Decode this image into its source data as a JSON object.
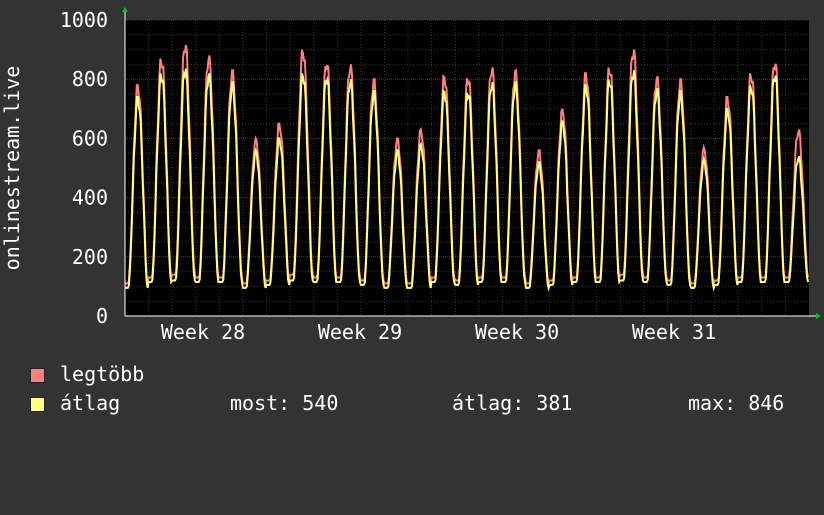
{
  "chart_data": {
    "type": "line",
    "ylabel": "onlinestream.live",
    "ylim": [
      0,
      1000
    ],
    "yticks": [
      0,
      200,
      400,
      600,
      800,
      1000
    ],
    "xticks": [
      "Week 28",
      "Week 29",
      "Week 30",
      "Week 31"
    ],
    "grid": true,
    "legend_position": "bottom-left",
    "series": [
      {
        "name": "legtöbb",
        "color": "#ff7f7f",
        "daily_peaks": [
          780,
          870,
          920,
          880,
          830,
          600,
          650,
          900,
          860,
          850,
          800,
          600,
          630,
          810,
          810,
          840,
          830,
          560,
          700,
          820,
          840,
          900,
          810,
          800,
          570,
          740,
          820,
          860,
          630
        ],
        "daily_mins": [
          110,
          130,
          140,
          130,
          130,
          110,
          120,
          140,
          130,
          130,
          120,
          110,
          110,
          130,
          120,
          130,
          130,
          110,
          120,
          130,
          130,
          140,
          130,
          120,
          110,
          120,
          130,
          130,
          130
        ]
      },
      {
        "name": "átlag",
        "color": "#ffff80",
        "daily_peaks": [
          740,
          820,
          840,
          820,
          790,
          560,
          600,
          820,
          810,
          800,
          760,
          560,
          580,
          760,
          760,
          790,
          790,
          520,
          660,
          780,
          800,
          830,
          770,
          760,
          530,
          700,
          780,
          820,
          540
        ],
        "daily_mins": [
          95,
          115,
          120,
          115,
          115,
          95,
          105,
          120,
          115,
          115,
          105,
          95,
          95,
          115,
          105,
          115,
          115,
          95,
          105,
          115,
          115,
          120,
          115,
          105,
          95,
          105,
          115,
          115,
          115
        ]
      }
    ]
  },
  "legend": [
    {
      "label": "legtöbb",
      "color": "#ff7f7f"
    },
    {
      "label": "átlag",
      "color": "#ffff80"
    }
  ],
  "stats": {
    "most": "most: 540",
    "atlag": "átlag: 381",
    "max": "max: 846"
  }
}
